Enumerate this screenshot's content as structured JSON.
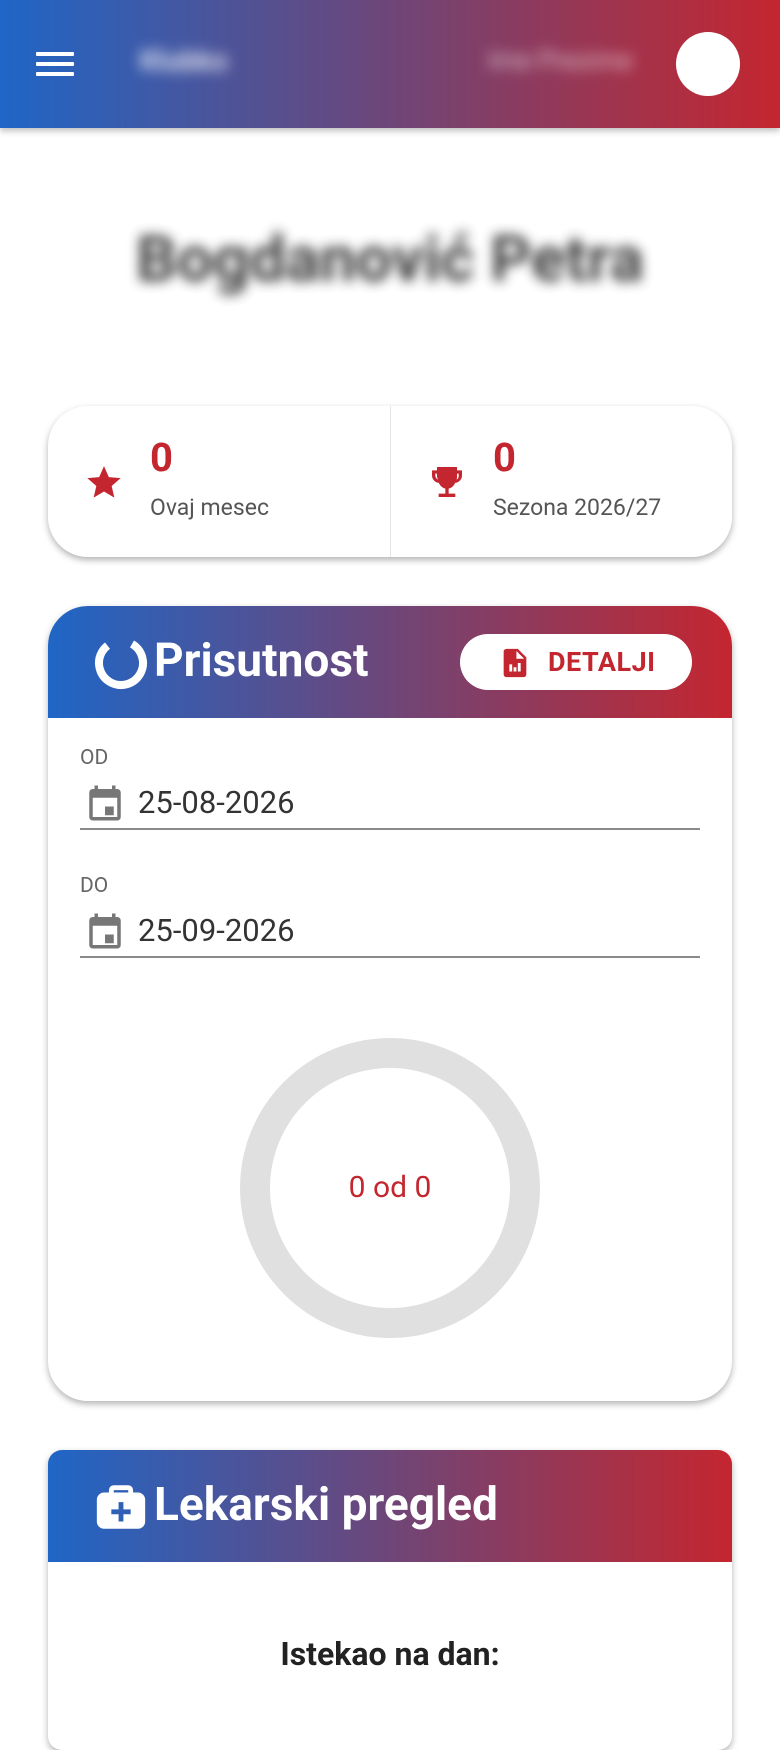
{
  "header": {
    "title": "Klubko",
    "user": "Ime Prezime"
  },
  "player": {
    "name": "Bogdanović Petra"
  },
  "stats": [
    {
      "value": "0",
      "label": "Ovaj mesec",
      "icon": "star-icon"
    },
    {
      "value": "0",
      "label": "Sezona 2026/27",
      "icon": "trophy-icon"
    }
  ],
  "attendance": {
    "title": "Prisutnost",
    "details_label": "DETALJI",
    "from_label": "OD",
    "from_value": "25-08-2026",
    "to_label": "DO",
    "to_value": "25-09-2026",
    "summary": "0 od 0",
    "attended": 0,
    "total": 0
  },
  "medical": {
    "title": "Lekarski pregled",
    "expired_label": "Istekao na dan:"
  },
  "colors": {
    "gradient_start": "#1f66c6",
    "gradient_end": "#c4262f",
    "accent": "#c4262f"
  }
}
